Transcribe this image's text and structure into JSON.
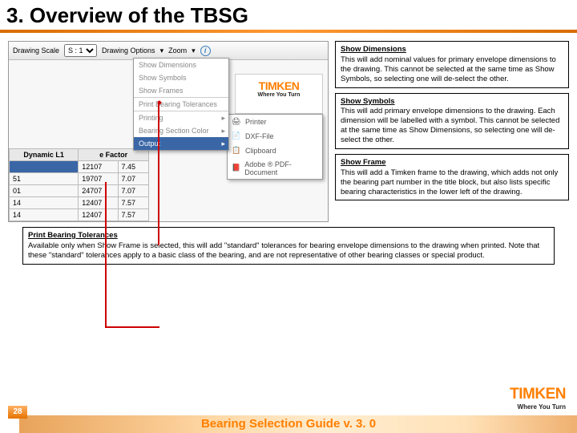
{
  "title": "3. Overview of the TBSG",
  "mock": {
    "drawing_scale_label": "Drawing Scale",
    "drawing_scale_value": "S : 1",
    "drawing_options_label": "Drawing Options",
    "zoom_label": "Zoom",
    "dd": {
      "show_dimensions": "Show Dimensions",
      "show_symbols": "Show Symbols",
      "show_frames": "Show Frames",
      "print_tolerances": "Print Bearing Tolerances",
      "printing": "Printing",
      "bearing_color": "Bearing Section Color",
      "output": "Output"
    },
    "submenu": {
      "printer": "Printer",
      "dxf": "DXF-File",
      "clipboard": "Clipboard",
      "pdf": "Adobe ® PDF-Document"
    },
    "table": {
      "h_dynamic": "Dynamic L1",
      "h_efactor": "e Factor",
      "rows": [
        [
          "51",
          "19707",
          "7.07"
        ],
        [
          "01",
          "24707",
          "7.07"
        ],
        [
          "14",
          "12407",
          "7.57"
        ],
        [
          "14",
          "12407",
          "7.57"
        ]
      ],
      "first_row": [
        "",
        "12107",
        "7.45"
      ]
    },
    "brand": {
      "name": "TIMKEN",
      "tag": "Where You Turn"
    }
  },
  "callouts": {
    "show_dimensions": {
      "title": "Show Dimensions",
      "body": "This will add nominal values for primary envelope dimensions to the drawing. This cannot be selected at the same time as Show Symbols, so selecting one will de-select the other."
    },
    "show_symbols": {
      "title": "Show Symbols",
      "body": "This will add primary envelope dimensions to the drawing. Each dimension will be labelled with a symbol. This cannot be selected at the same time as Show Dimensions, so selecting one will de-select the other."
    },
    "show_frame": {
      "title": "Show Frame",
      "body": "This will add a Timken frame to the drawing, which adds not only the bearing part number in the title block, but also lists specific bearing characteristics in the lower left of the drawing."
    },
    "print_tolerances": {
      "title": "Print Bearing Tolerances",
      "body": "Available only when Show Frame is selected, this will add \"standard\" tolerances for bearing envelope dimensions to the drawing when printed. Note that these \"standard\" tolerances apply to a basic class of the bearing, and are not representative of other bearing classes or special product."
    }
  },
  "footer": {
    "page": "28",
    "title": "Bearing Selection Guide v. 3. 0"
  }
}
